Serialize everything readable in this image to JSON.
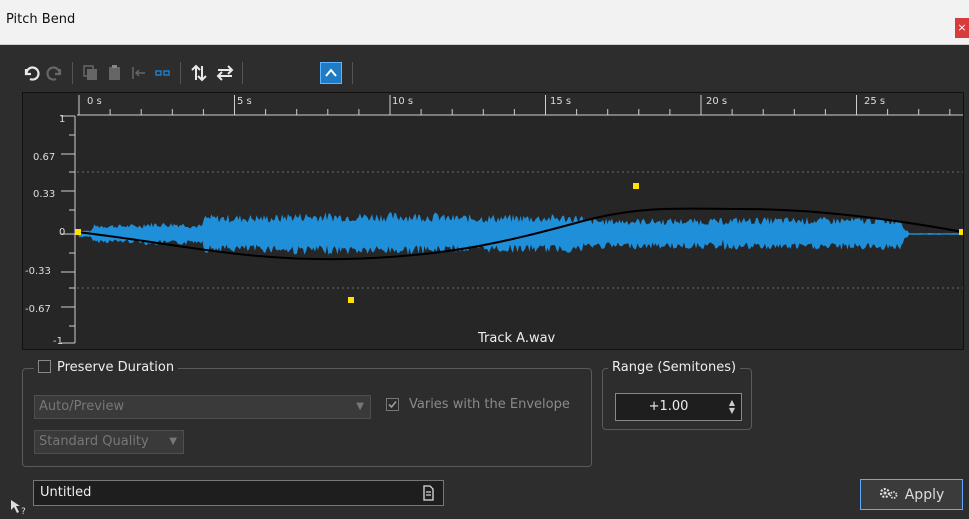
{
  "window": {
    "title": "Pitch Bend",
    "close_glyph": "×"
  },
  "toolbar": {
    "icons": [
      "undo-icon",
      "redo-icon",
      "copy-icon",
      "paste-icon",
      "reset-to-start-icon",
      "select-points-icon",
      "flip-vertical-icon",
      "reverse-icon",
      "envelope-curve-icon"
    ]
  },
  "waveform": {
    "ruler": [
      "0 s",
      "5 s",
      "10 s",
      "15 s",
      "20 s",
      "25 s"
    ],
    "y_axis": [
      "1",
      "0.67",
      "0.33",
      "0",
      "-0.33",
      "-0.67",
      "-1"
    ],
    "track_name": "Track A.wav",
    "colors": {
      "wave": "#1e8fd8",
      "curve": "#000000",
      "points": "#ffe000"
    }
  },
  "preserve": {
    "label": "Preserve Duration",
    "checked": false,
    "mode_value": "Auto/Preview",
    "varies_label": "Varies with the Envelope",
    "varies_checked": true,
    "quality_value": "Standard Quality"
  },
  "range": {
    "label": "Range (Semitones)",
    "value": "+1.00"
  },
  "footer": {
    "preset_name": "Untitled",
    "apply_label": "Apply"
  }
}
